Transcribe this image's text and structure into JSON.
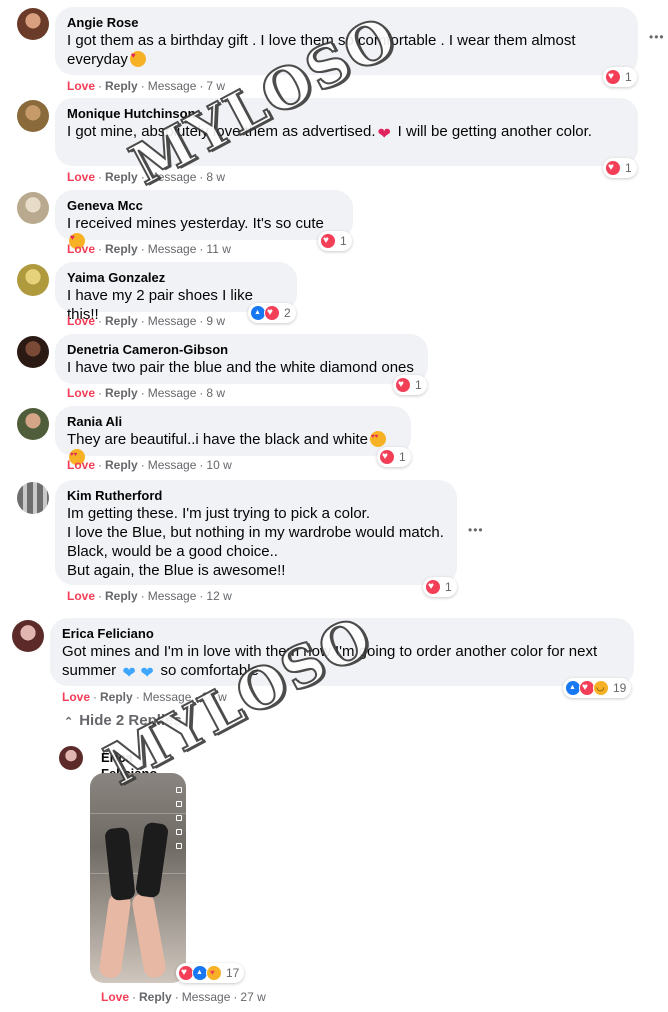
{
  "action_labels": {
    "love": "Love",
    "reply": "Reply",
    "message": "Message",
    "dot": "·"
  },
  "more_options": "•••",
  "watermark": "MYLOSO",
  "comments": [
    {
      "author": "Angie Rose",
      "text": "I got them as a birthday gift . I love them so comfortable . I wear them almost everyday",
      "emoji": "smiling-face-with-hearts",
      "time": "7 w",
      "reactions": [
        "love"
      ],
      "reaction_count": "1"
    },
    {
      "author": "Monique Hutchinson",
      "text": "I got mine, absolutely love them as advertised.",
      "text_tail": " I will be getting another color.",
      "emoji": "red-heart",
      "time": "8 w",
      "reactions": [
        "love"
      ],
      "reaction_count": "1"
    },
    {
      "author": "Geneva Mcc",
      "text": "I received mines yesterday. It's so cute",
      "emoji": "smiling-face-with-hearts",
      "time": "11 w",
      "reactions": [
        "love"
      ],
      "reaction_count": "1"
    },
    {
      "author": "Yaima Gonzalez",
      "text": "I have my 2 pair shoes I like this!!",
      "time": "9 w",
      "reactions": [
        "like",
        "love"
      ],
      "reaction_count": "2"
    },
    {
      "author": "Denetria Cameron-Gibson",
      "text": "I have two pair the blue and the white diamond ones",
      "time": "8 w",
      "reactions": [
        "love"
      ],
      "reaction_count": "1"
    },
    {
      "author": "Rania Ali",
      "text": "They are beautiful..i have the black and white",
      "emoji": "heart-eyes",
      "time": "10 w",
      "reactions": [
        "love"
      ],
      "reaction_count": "1"
    },
    {
      "author": "Kim Rutherford",
      "text": "Im getting these. I'm just trying to pick a color.\nI love the Blue, but nothing in my wardrobe would match.\nBlack, would be a good choice..\nBut again, the Blue is awesome!!",
      "time": "12 w",
      "reactions": [
        "love"
      ],
      "reaction_count": "1"
    },
    {
      "author": "Erica Feliciano",
      "text": "Got mines and I'm in love with them now I'm going to order another color for next summer",
      "text_tail": " so comfortable",
      "emoji": "blue-hearts",
      "time": "10 w",
      "reactions": [
        "like",
        "love",
        "haha"
      ],
      "reaction_count": "19"
    }
  ],
  "hide_replies": "Hide 2 Replies",
  "reply": {
    "author": "Erica Feliciano",
    "time": "27 w",
    "reactions": [
      "love",
      "like",
      "care"
    ],
    "reaction_count": "17"
  }
}
